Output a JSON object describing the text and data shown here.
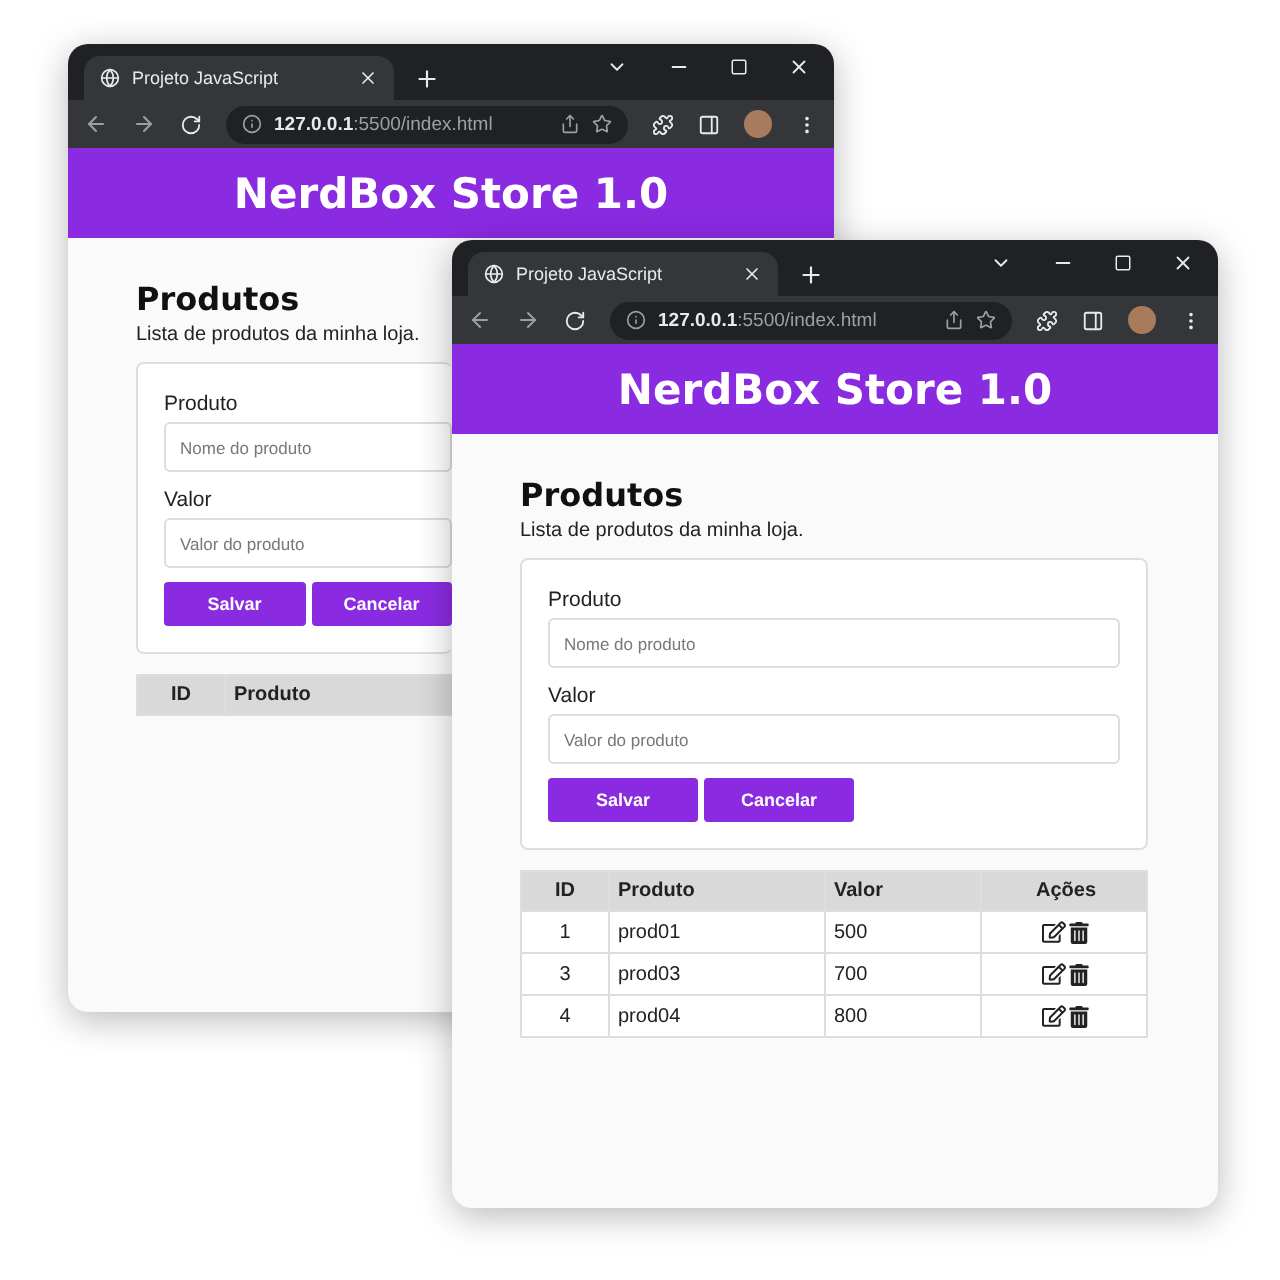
{
  "windows": [
    {
      "tab_title": "Projeto JavaScript",
      "url_host": "127.0.0.1",
      "url_path": ":5500/index.html",
      "header": "NerdBox Store 1.0",
      "heading": "Produtos",
      "subtitle": "Lista de produtos da minha loja.",
      "fields": [
        {
          "label": "Produto",
          "placeholder": "Nome do produto"
        },
        {
          "label": "Valor",
          "placeholder": "Valor do produto"
        }
      ],
      "buttons": [
        "Salvar",
        "Cancelar"
      ],
      "table": {
        "columns": [
          "ID",
          "Produto"
        ]
      }
    },
    {
      "tab_title": "Projeto JavaScript",
      "url_host": "127.0.0.1",
      "url_path": ":5500/index.html",
      "header": "NerdBox Store 1.0",
      "heading": "Produtos",
      "subtitle": "Lista de produtos da minha loja.",
      "fields": [
        {
          "label": "Produto",
          "placeholder": "Nome do produto"
        },
        {
          "label": "Valor",
          "placeholder": "Valor do produto"
        }
      ],
      "buttons": [
        "Salvar",
        "Cancelar"
      ],
      "table": {
        "columns": [
          "ID",
          "Produto",
          "Valor",
          "Ações"
        ],
        "rows": [
          {
            "id": "1",
            "produto": "prod01",
            "valor": "500"
          },
          {
            "id": "3",
            "produto": "prod03",
            "valor": "700"
          },
          {
            "id": "4",
            "produto": "prod04",
            "valor": "800"
          }
        ]
      }
    }
  ]
}
